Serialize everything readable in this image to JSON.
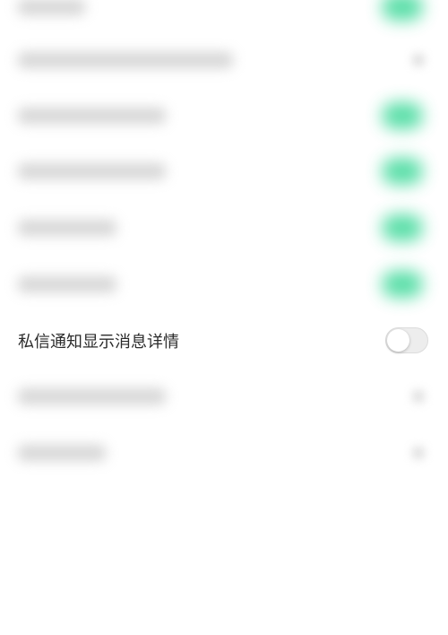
{
  "settings": {
    "rows": [
      {
        "state": "blurred",
        "trailing": "toggle-on"
      },
      {
        "state": "blurred",
        "trailing": "chevron"
      },
      {
        "state": "blurred",
        "trailing": "toggle-on"
      },
      {
        "state": "blurred",
        "trailing": "toggle-on"
      },
      {
        "state": "blurred",
        "trailing": "toggle-on"
      },
      {
        "state": "blurred",
        "trailing": "toggle-on"
      },
      {
        "state": "visible",
        "label": "私信通知显示消息详情",
        "trailing": "toggle",
        "toggle_on": false
      },
      {
        "state": "blurred",
        "trailing": "chevron"
      },
      {
        "state": "blurred",
        "trailing": "chevron"
      }
    ]
  },
  "colors": {
    "accent_green": "#3fd99a",
    "toggle_off_track": "#ededed",
    "text_primary": "#2b2b2b",
    "background": "#ffffff"
  }
}
